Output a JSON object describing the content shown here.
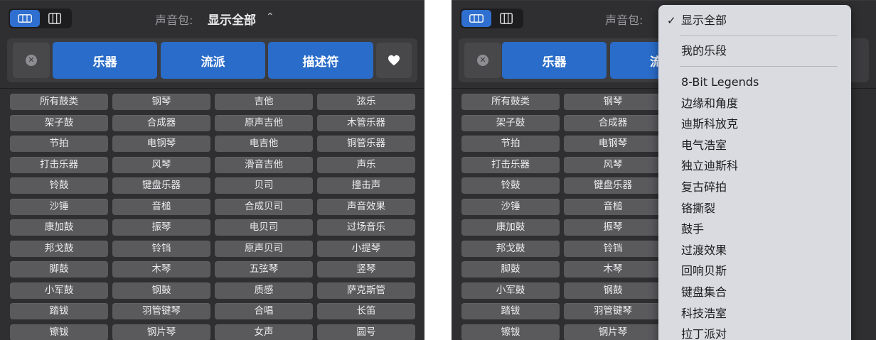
{
  "toolbar": {
    "sound_pack_label": "声音包:",
    "sound_pack_value": "显示全部",
    "view_modes": [
      "button-view",
      "column-view"
    ]
  },
  "filters": {
    "categories": [
      "乐器",
      "流派",
      "描述符"
    ]
  },
  "keywords": [
    [
      "所有鼓类",
      "钢琴",
      "吉他",
      "弦乐"
    ],
    [
      "架子鼓",
      "合成器",
      "原声吉他",
      "木管乐器"
    ],
    [
      "节拍",
      "电钢琴",
      "电吉他",
      "铜管乐器"
    ],
    [
      "打击乐器",
      "风琴",
      "滑音吉他",
      "声乐"
    ],
    [
      "铃鼓",
      "键盘乐器",
      "贝司",
      "撞击声"
    ],
    [
      "沙锤",
      "音槌",
      "合成贝司",
      "声音效果"
    ],
    [
      "康加鼓",
      "振琴",
      "电贝司",
      "过场音乐"
    ],
    [
      "邦戈鼓",
      "铃铛",
      "原声贝司",
      "小提琴"
    ],
    [
      "脚鼓",
      "木琴",
      "五弦琴",
      "竖琴"
    ],
    [
      "小军鼓",
      "钢鼓",
      "质感",
      "萨克斯管"
    ],
    [
      "踏钹",
      "羽管键琴",
      "合唱",
      "长笛"
    ],
    [
      "镲钹",
      "钢片琴",
      "女声",
      "圆号"
    ]
  ],
  "dropdown": {
    "selected": "显示全部",
    "my_loops": "我的乐段",
    "packs": [
      "8-Bit Legends",
      "边缘和角度",
      "迪斯科放克",
      "电气浩室",
      "独立迪斯科",
      "复古碎拍",
      "铬撕裂",
      "鼓手",
      "过渡效果",
      "回响贝斯",
      "键盘集合",
      "科技浩室",
      "拉丁派对"
    ]
  },
  "colors": {
    "panel_bg": "#2f2f31",
    "accent_blue": "#2a6cc9",
    "keyword_bg": "#5a5a5d",
    "menu_bg": "#d9dbe1"
  },
  "icons": {
    "clear": "x-circle-icon",
    "favorite": "heart-icon",
    "chevron": "up-down-chevron-icon",
    "checkmark": "checkmark-icon"
  }
}
